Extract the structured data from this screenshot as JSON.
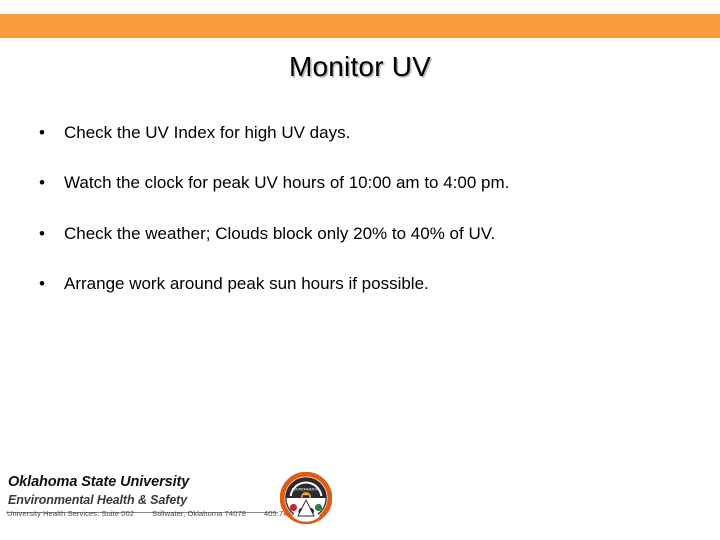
{
  "slide": {
    "title": "Monitor UV",
    "accent_color": "#fa9a3e",
    "background_color": "#ffffff",
    "text_color": "#000000"
  },
  "bullets": [
    {
      "marker": "•",
      "text": "Check the UV Index for high UV days."
    },
    {
      "marker": "•",
      "text": "Watch the clock for peak UV hours of 10:00 am to 4:00 pm."
    },
    {
      "marker": "•",
      "text": "Check the weather; Clouds block only 20% to 40% of UV."
    },
    {
      "marker": "•",
      "text": "Arrange work around peak sun hours if possible."
    }
  ],
  "footer": {
    "organization": "Oklahoma State University",
    "department": "Environmental Health & Safety",
    "address_building": "University Health Services, Suite 002",
    "address_city": "Stillwater, Oklahoma 74078",
    "phone": "405.744.7241",
    "seal": {
      "name": "osu-ehs-seal",
      "ring_color": "#E15A16",
      "inner_color": "#ffffff",
      "dark_color": "#2b2b2b"
    }
  }
}
